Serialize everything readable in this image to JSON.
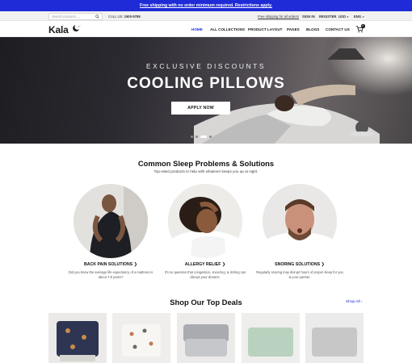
{
  "announcement": {
    "text": "Free shipping with no order minimum required. Restrictions apply."
  },
  "utility": {
    "search_placeholder": "Search products ...",
    "call_label": "CALL US:",
    "call_number": "1900-5789",
    "free_shipping": "Free shipping for all orders!",
    "sign_in": "SIGN IN",
    "register": "REGISTER",
    "currency": "USD",
    "language": "ENG"
  },
  "nav": {
    "logo": "Kala",
    "items": [
      {
        "label": "HOME"
      },
      {
        "label": "ALL COLLECTIONS"
      },
      {
        "label": "PRODUCT LAYOUT"
      },
      {
        "label": "PAGES"
      },
      {
        "label": "BLOGS"
      },
      {
        "label": "CONTACT US"
      }
    ],
    "cart_count": "0"
  },
  "hero": {
    "kicker": "EXCLUSIVE DISCOUNTS",
    "title": "COOLING PILLOWS",
    "button": "APPLY NOW",
    "slides": 4,
    "active_slide": 3
  },
  "problems": {
    "title": "Common Sleep Problems & Solutions",
    "subtitle": "Top-rated products to help with whatever keeps you up at night.",
    "items": [
      {
        "title": "BACK PAIN SOLUTIONS",
        "desc": "Did you know the average life expectancy of a mattress is about 7-8 years?"
      },
      {
        "title": "ALLERGY RELIEF",
        "desc": "It's no question that congestion, sneezing, & itching can disrupt your dreams."
      },
      {
        "title": "SNORING SOLUTIONS",
        "desc": "Regularly snoring may disrupt hours of proper sleep for you & your partner."
      }
    ]
  },
  "deals": {
    "title": "Shop Our Top Deals",
    "shop_all": "Shop All"
  },
  "colors": {
    "accent": "#1f2bd6",
    "text": "#1a1a1a"
  }
}
